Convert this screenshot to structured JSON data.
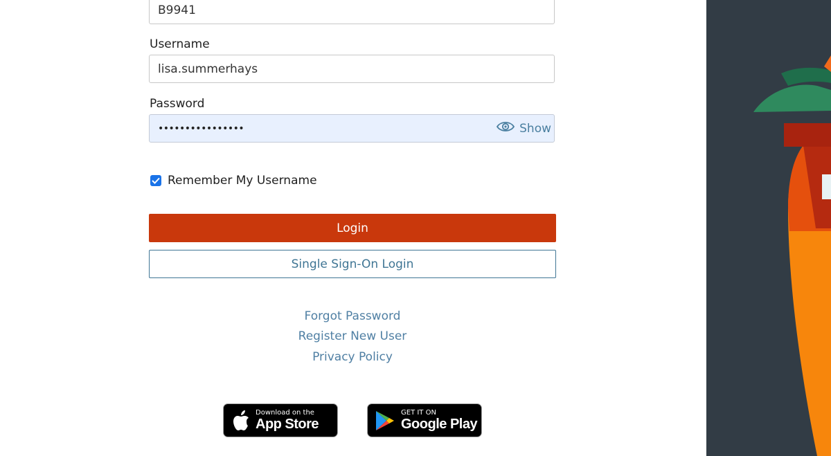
{
  "form": {
    "company_field_value": "B9941",
    "username_label": "Username",
    "username_value": "lisa.summerhays",
    "password_label": "Password",
    "password_masked": "••••••••••••••••",
    "show_label": "Show",
    "remember_label": "Remember My Username",
    "remember_checked": true,
    "login_label": "Login",
    "sso_label": "Single Sign-On Login"
  },
  "links": {
    "forgot_password": "Forgot Password",
    "register": "Register New User",
    "privacy": "Privacy Policy"
  },
  "badges": {
    "app_store_small": "Download on the",
    "app_store_big": "App Store",
    "google_small": "GET IT ON",
    "google_big": "Google Play"
  },
  "colors": {
    "login_button": "#c9380c",
    "sso_border": "#3f7594",
    "link": "#4f7fa3",
    "side_panel": "#323c45"
  }
}
